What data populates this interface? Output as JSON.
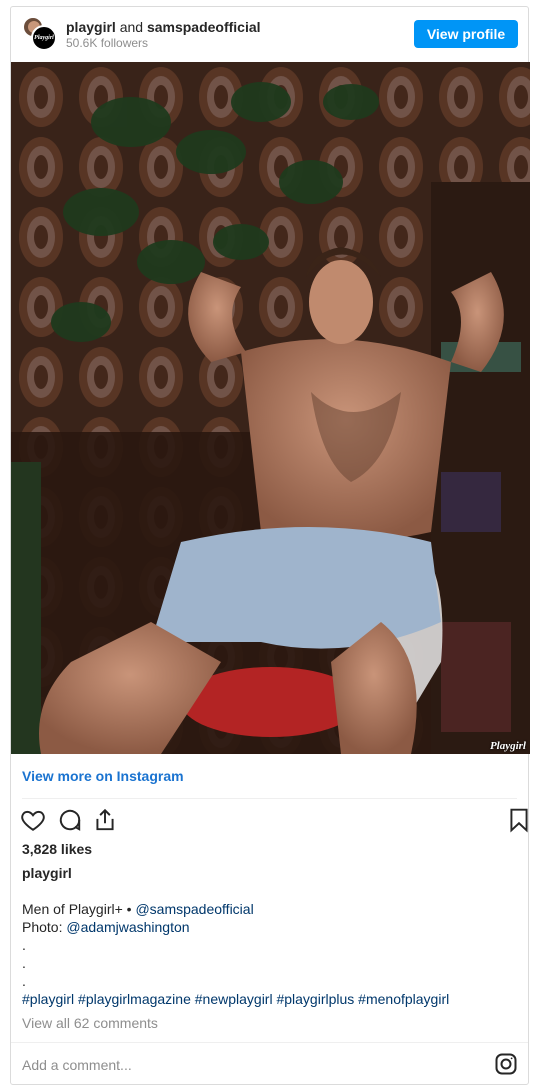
{
  "header": {
    "account1": "playgirl",
    "conjunction": "and",
    "account2": "samspadeofficial",
    "followers": "50.6K followers",
    "view_profile_label": "View profile",
    "avatar_logo_text": "Playgirl"
  },
  "photo": {
    "watermark": "Playgirl"
  },
  "view_more_label": "View more on Instagram",
  "likes": "3,828 likes",
  "owner": "playgirl",
  "caption": {
    "line1_text": "Men of Playgirl+ • ",
    "line1_mention": "@samspadeofficial",
    "line2_text": "Photo: ",
    "line2_mention": "@adamjwashington",
    "dots": [
      ".",
      ".",
      "."
    ],
    "hashtags": "#playgirl #playgirlmagazine #newplaygirl #playgirlplus #menofplaygirl"
  },
  "comments_link": "View all 62 comments",
  "add_comment_placeholder": "Add a comment...",
  "colors": {
    "accent": "#0095f6",
    "link": "#00376b",
    "muted": "#8e8e8e"
  },
  "icons": [
    "heart-icon",
    "comment-icon",
    "share-icon",
    "bookmark-icon",
    "instagram-icon"
  ]
}
